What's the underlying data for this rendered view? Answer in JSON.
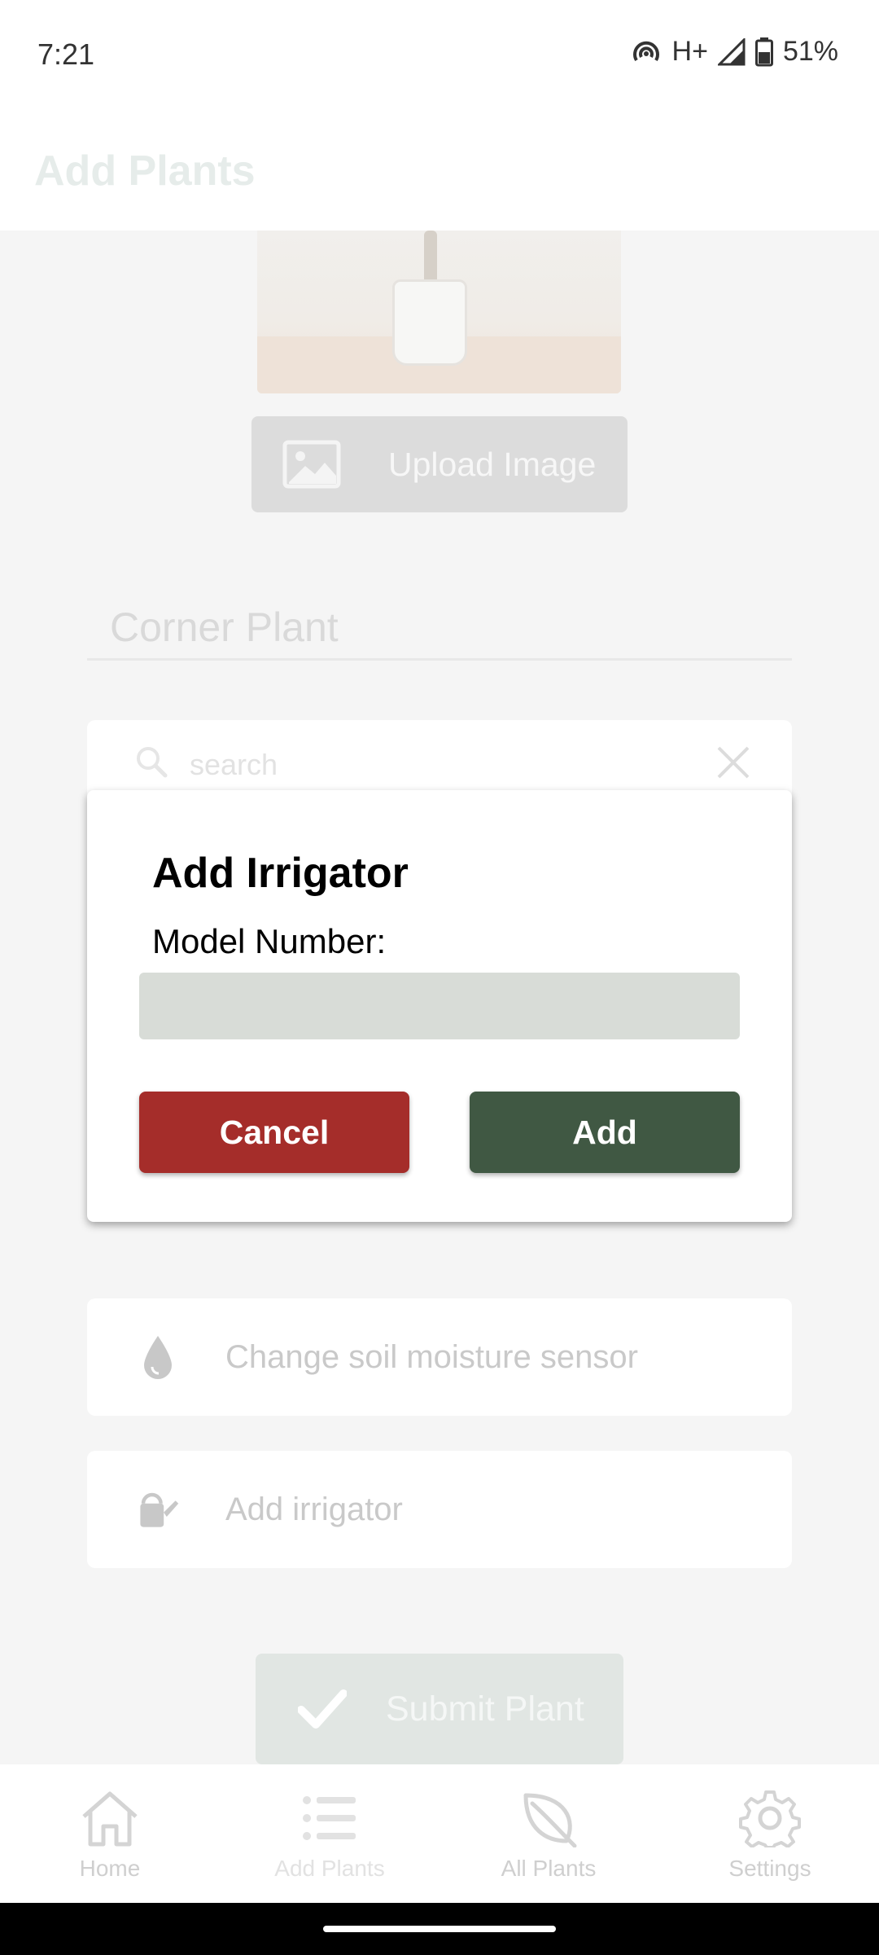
{
  "status_bar": {
    "time": "7:21",
    "network": "H+",
    "battery": "51%"
  },
  "header": {
    "title": "Add Plants"
  },
  "form": {
    "upload_button_label": "Upload Image",
    "plant_name_value": "Corner Plant",
    "search_placeholder": "search",
    "options": [
      {
        "label": "Change soil moisture sensor",
        "icon": "water-drop-icon"
      },
      {
        "label": "Add irrigator",
        "icon": "watering-can-icon"
      }
    ],
    "submit_label": "Submit Plant"
  },
  "dialog": {
    "title": "Add Irrigator",
    "field_label": "Model Number:",
    "field_value": "",
    "cancel_label": "Cancel",
    "add_label": "Add"
  },
  "bottom_nav": {
    "items": [
      {
        "label": "Home",
        "icon": "home-icon"
      },
      {
        "label": "Add Plants",
        "icon": "list-icon"
      },
      {
        "label": "All Plants",
        "icon": "leaf-icon"
      },
      {
        "label": "Settings",
        "icon": "gear-icon"
      }
    ]
  },
  "colors": {
    "cancel": "#a52d2a",
    "add": "#405843",
    "input_bg": "#d8dcd7"
  }
}
